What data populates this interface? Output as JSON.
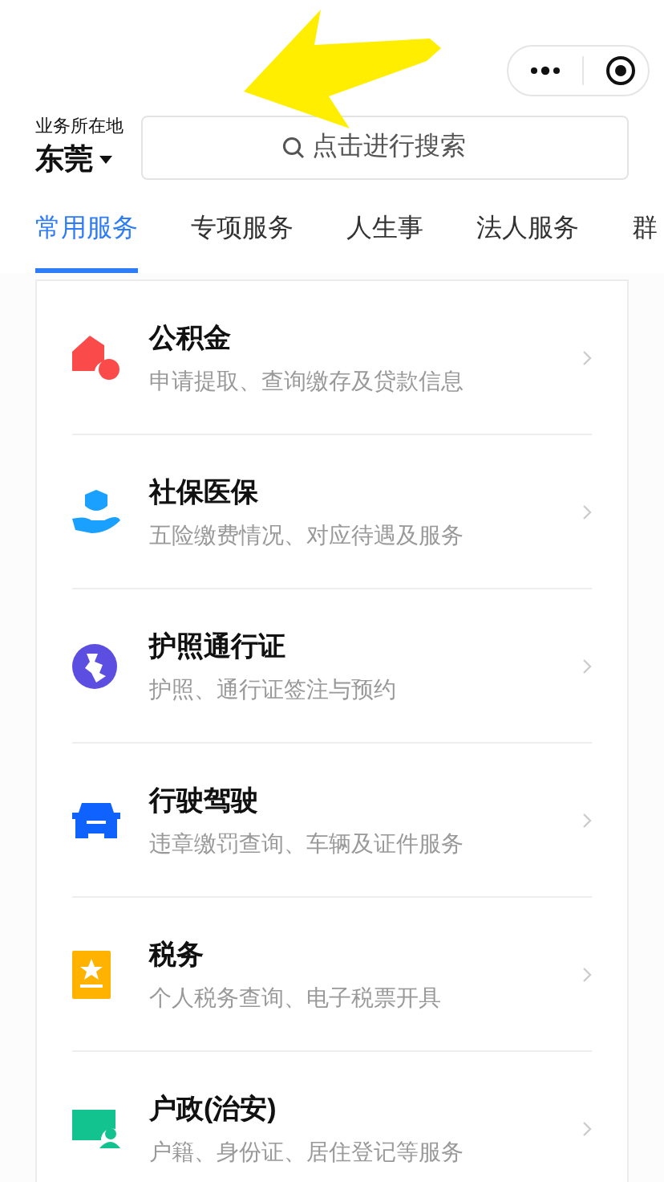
{
  "location": {
    "label": "业务所在地",
    "city": "东莞"
  },
  "search": {
    "placeholder": "点击进行搜索"
  },
  "tabs": [
    {
      "label": "常用服务",
      "selected": true
    },
    {
      "label": "专项服务",
      "selected": false
    },
    {
      "label": "人生事",
      "selected": false
    },
    {
      "label": "法人服务",
      "selected": false
    },
    {
      "label": "群",
      "selected": false
    }
  ],
  "services": [
    {
      "title": "公积金",
      "subtitle": "申请提取、查询缴存及贷款信息"
    },
    {
      "title": "社保医保",
      "subtitle": "五险缴费情况、对应待遇及服务"
    },
    {
      "title": "护照通行证",
      "subtitle": "护照、通行证签注与预约"
    },
    {
      "title": "行驶驾驶",
      "subtitle": "违章缴罚查询、车辆及证件服务"
    },
    {
      "title": "税务",
      "subtitle": "个人税务查询、电子税票开具"
    },
    {
      "title": "户政(治安)",
      "subtitle": "户籍、身份证、居住登记等服务"
    }
  ]
}
